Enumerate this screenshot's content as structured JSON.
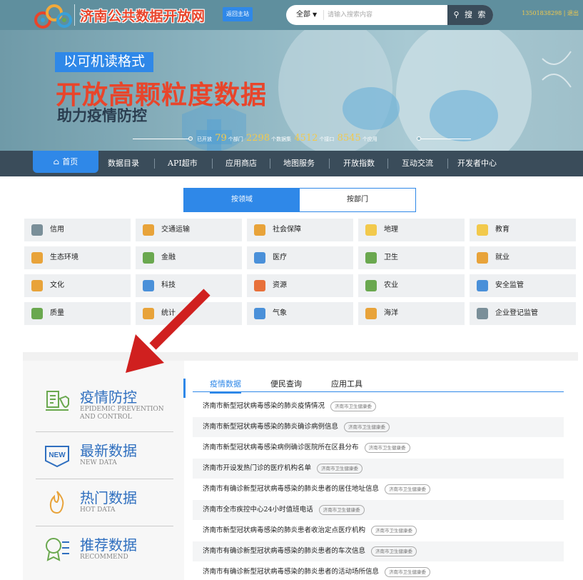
{
  "header": {
    "site_title": "济南公共数据开放网",
    "home_button": "返回主站",
    "search": {
      "scope": "全部",
      "placeholder": "请输入搜索内容",
      "button": "搜 索"
    },
    "user": "13501838298 | 退出"
  },
  "banner": {
    "line1": "以可机读格式",
    "line2": "开放高颗粒度数据",
    "line3": "助力疫情防控",
    "stats": {
      "prefix": "已开放",
      "departments": "79",
      "departments_unit": "个部门",
      "datasets": "2298",
      "datasets_unit": "个数据集",
      "apis": "4512",
      "apis_unit": "个接口",
      "apps": "8545",
      "apps_unit": "个应用"
    }
  },
  "nav": {
    "items": [
      "首页",
      "数据目录",
      "API超市",
      "应用商店",
      "地图服务",
      "开放指数",
      "互动交流",
      "开发者中心"
    ]
  },
  "category_tabs": [
    "按领域",
    "按部门"
  ],
  "categories": [
    {
      "label": "信用",
      "icon": "credit-icon",
      "color": "#7a8f99"
    },
    {
      "label": "交通运输",
      "icon": "transport-icon",
      "color": "#e8a33a"
    },
    {
      "label": "社会保障",
      "icon": "social-security-icon",
      "color": "#e8a33a"
    },
    {
      "label": "地理",
      "icon": "geography-icon",
      "color": "#f2c94c"
    },
    {
      "label": "教育",
      "icon": "education-icon",
      "color": "#f2c94c"
    },
    {
      "label": "生态环境",
      "icon": "ecology-icon",
      "color": "#e8a33a"
    },
    {
      "label": "金融",
      "icon": "finance-icon",
      "color": "#6aa84f"
    },
    {
      "label": "医疗",
      "icon": "medical-icon",
      "color": "#4a90d9"
    },
    {
      "label": "卫生",
      "icon": "health-icon",
      "color": "#6aa84f"
    },
    {
      "label": "就业",
      "icon": "employment-icon",
      "color": "#e8a33a"
    },
    {
      "label": "文化",
      "icon": "culture-icon",
      "color": "#e8a33a"
    },
    {
      "label": "科技",
      "icon": "technology-icon",
      "color": "#4a90d9"
    },
    {
      "label": "资源",
      "icon": "resources-icon",
      "color": "#e8703a"
    },
    {
      "label": "农业",
      "icon": "agriculture-icon",
      "color": "#6aa84f"
    },
    {
      "label": "安全监管",
      "icon": "safety-icon",
      "color": "#4a90d9"
    },
    {
      "label": "质量",
      "icon": "quality-icon",
      "color": "#6aa84f"
    },
    {
      "label": "统计",
      "icon": "statistics-icon",
      "color": "#e8a33a"
    },
    {
      "label": "气象",
      "icon": "weather-icon",
      "color": "#4a90d9"
    },
    {
      "label": "海洋",
      "icon": "ocean-icon",
      "color": "#e8a33a"
    },
    {
      "label": "企业登记监管",
      "icon": "enterprise-icon",
      "color": "#7a8f99"
    }
  ],
  "sidebar": {
    "items": [
      {
        "title": "疫情防控",
        "subtitle": "EPIDEMIC PREVENTION AND CONTROL",
        "icon": "epidemic-icon"
      },
      {
        "title": "最新数据",
        "subtitle": "NEW DATA",
        "icon": "new-icon"
      },
      {
        "title": "热门数据",
        "subtitle": "HOT DATA",
        "icon": "fire-icon"
      },
      {
        "title": "推荐数据",
        "subtitle": "RECOMMEND",
        "icon": "badge-icon"
      }
    ]
  },
  "sub_tabs": [
    "疫情数据",
    "便民查询",
    "应用工具"
  ],
  "list": [
    {
      "title": "济南市新型冠状病毒感染的肺炎疫情情况",
      "tag": "济南市卫生健康委"
    },
    {
      "title": "济南市新型冠状病毒感染的肺炎确诊病例信息",
      "tag": "济南市卫生健康委"
    },
    {
      "title": "济南市新型冠状病毒感染病例确诊医院所在区县分布",
      "tag": "济南市卫生健康委"
    },
    {
      "title": "济南市开设发热门诊的医疗机构名单",
      "tag": "济南市卫生健康委"
    },
    {
      "title": "济南市有确诊新型冠状病毒感染的肺炎患者的居住地址信息",
      "tag": "济南市卫生健康委"
    },
    {
      "title": "济南市全市疾控中心24小时值班电话",
      "tag": "济南市卫生健康委"
    },
    {
      "title": "济南市新型冠状病毒感染的肺炎患者收治定点医疗机构",
      "tag": "济南市卫生健康委"
    },
    {
      "title": "济南市有确诊新型冠状病毒感染的肺炎患者的车次信息",
      "tag": "济南市卫生健康委"
    },
    {
      "title": "济南市有确诊新型冠状病毒感染的肺炎患者的活动场所信息",
      "tag": "济南市卫生健康委"
    }
  ],
  "colors": {
    "primary": "#2f88e8",
    "nav": "#3a4c5a",
    "title_red": "#e8452b",
    "stat_yellow": "#f2c94c"
  }
}
